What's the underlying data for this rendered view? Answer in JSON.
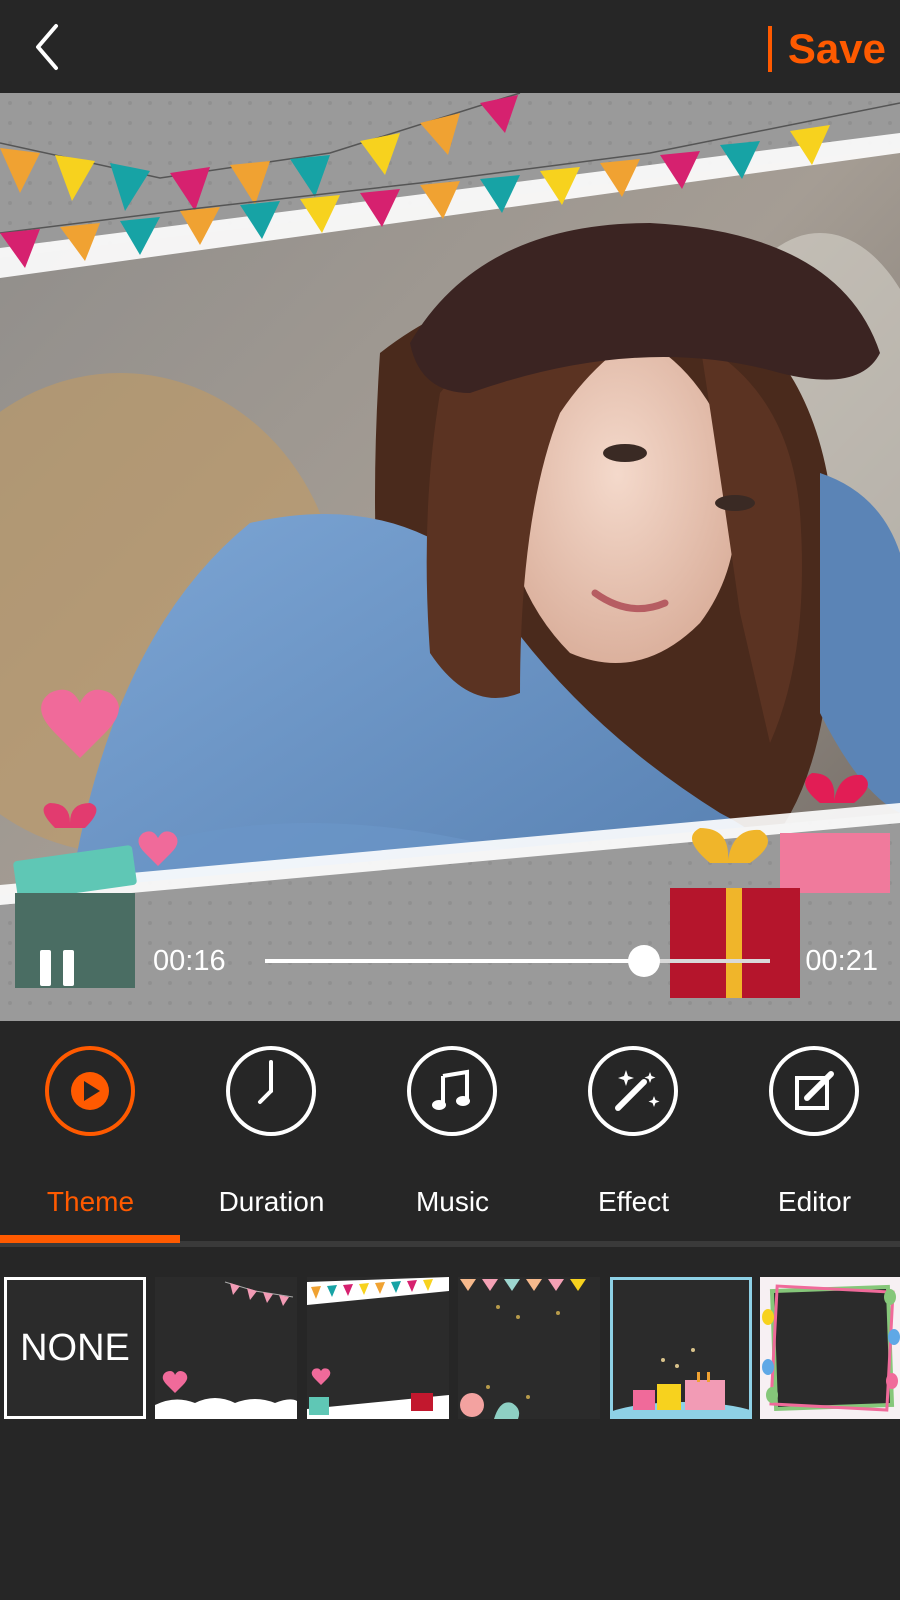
{
  "header": {
    "save_label": "Save"
  },
  "player": {
    "current_time": "00:16",
    "total_time": "00:21",
    "progress": 0.75
  },
  "tools": [
    {
      "label": "Theme",
      "icon": "play-icon",
      "active": true
    },
    {
      "label": "Duration",
      "icon": "clock-icon",
      "active": false
    },
    {
      "label": "Music",
      "icon": "music-note-icon",
      "active": false
    },
    {
      "label": "Effect",
      "icon": "magic-wand-icon",
      "active": false
    },
    {
      "label": "Editor",
      "icon": "edit-icon",
      "active": false
    }
  ],
  "themes": [
    {
      "label": "NONE"
    }
  ],
  "colors": {
    "accent": "#ff5a00",
    "background": "#262626"
  }
}
